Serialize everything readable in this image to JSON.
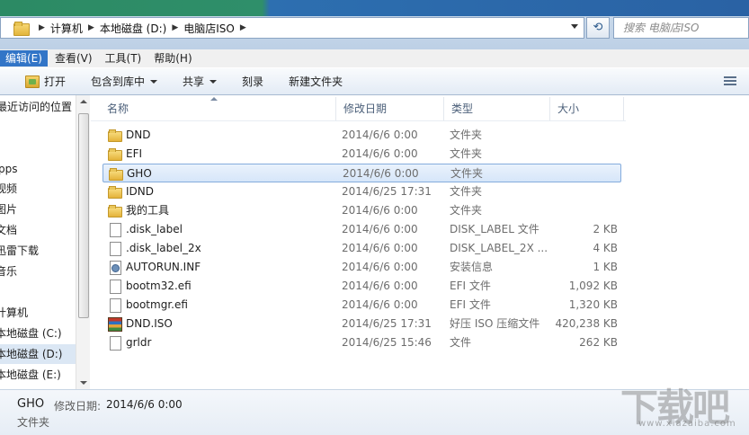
{
  "address_bar": {
    "crumbs": [
      "计算机",
      "本地磁盘 (D:)",
      "电脑店ISO"
    ],
    "search_placeholder": "搜索 电脑店ISO",
    "refresh_symbol": "⟲"
  },
  "menubar": {
    "items": [
      "编辑(E)",
      "查看(V)",
      "工具(T)",
      "帮助(H)"
    ],
    "active_index": 0
  },
  "toolbar": {
    "open": "打开",
    "include_in_library": "包含到库中",
    "share": "共享",
    "burn": "刻录",
    "new_folder": "新建文件夹"
  },
  "nav_pane": {
    "items": [
      {
        "label": "最近访问的位置"
      },
      {
        "label": "pps"
      },
      {
        "label": "视频"
      },
      {
        "label": "图片"
      },
      {
        "label": "文档"
      },
      {
        "label": "迅雷下载"
      },
      {
        "label": "音乐"
      },
      {
        "label": "计算机"
      },
      {
        "label": "本地磁盘 (C:)"
      },
      {
        "label": "本地磁盘 (D:)"
      },
      {
        "label": "本地磁盘 (E:)"
      }
    ]
  },
  "file_list": {
    "columns": {
      "name": "名称",
      "modified": "修改日期",
      "type": "类型",
      "size": "大小"
    },
    "rows": [
      {
        "name": "DND",
        "modified": "2014/6/6 0:00",
        "type": "文件夹",
        "size": "",
        "icon": "folder-icon"
      },
      {
        "name": "EFI",
        "modified": "2014/6/6 0:00",
        "type": "文件夹",
        "size": "",
        "icon": "folder-icon"
      },
      {
        "name": "GHO",
        "modified": "2014/6/6 0:00",
        "type": "文件夹",
        "size": "",
        "icon": "folder-icon",
        "selected": true
      },
      {
        "name": "IDND",
        "modified": "2014/6/25 17:31",
        "type": "文件夹",
        "size": "",
        "icon": "folder-icon"
      },
      {
        "name": "我的工具",
        "modified": "2014/6/6 0:00",
        "type": "文件夹",
        "size": "",
        "icon": "folder-icon"
      },
      {
        "name": ".disk_label",
        "modified": "2014/6/6 0:00",
        "type": "DISK_LABEL 文件",
        "size": "2 KB",
        "icon": "file-icon"
      },
      {
        "name": ".disk_label_2x",
        "modified": "2014/6/6 0:00",
        "type": "DISK_LABEL_2X ...",
        "size": "4 KB",
        "icon": "file-icon"
      },
      {
        "name": "AUTORUN.INF",
        "modified": "2014/6/6 0:00",
        "type": "安装信息",
        "size": "1 KB",
        "icon": "inf-file-icon"
      },
      {
        "name": "bootm32.efi",
        "modified": "2014/6/6 0:00",
        "type": "EFI 文件",
        "size": "1,092 KB",
        "icon": "file-icon"
      },
      {
        "name": "bootmgr.efi",
        "modified": "2014/6/6 0:00",
        "type": "EFI 文件",
        "size": "1,320 KB",
        "icon": "file-icon"
      },
      {
        "name": "DND.ISO",
        "modified": "2014/6/25 17:31",
        "type": "好压 ISO 压缩文件",
        "size": "420,238 KB",
        "icon": "archive-icon"
      },
      {
        "name": "grldr",
        "modified": "2014/6/25 15:46",
        "type": "文件",
        "size": "262 KB",
        "icon": "file-icon"
      }
    ]
  },
  "details": {
    "name": "GHO",
    "modified_label": "修改日期:",
    "modified_value": "2014/6/6 0:00",
    "type": "文件夹"
  },
  "watermark": {
    "text": "下载吧",
    "url": "www.xiazaiba.com"
  }
}
